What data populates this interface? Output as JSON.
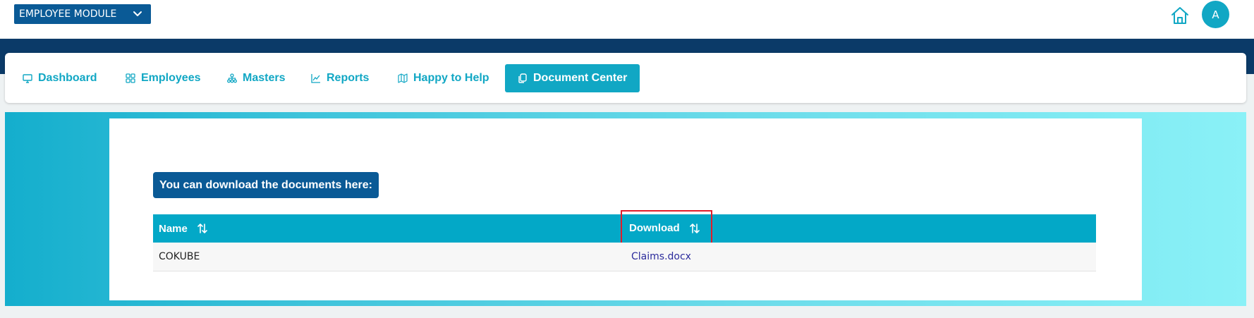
{
  "topbar": {
    "module_label": "EMPLOYEE MODULE",
    "avatar_initial": "A",
    "home_icon": "home-icon",
    "chevron_icon": "chevron-down-icon"
  },
  "nav": {
    "items": [
      {
        "label": "Dashboard",
        "icon": "monitor-icon"
      },
      {
        "label": "Employees",
        "icon": "grid-icon"
      },
      {
        "label": "Masters",
        "icon": "hierarchy-icon"
      },
      {
        "label": "Reports",
        "icon": "chart-line-icon"
      },
      {
        "label": "Happy to Help",
        "icon": "map-icon"
      },
      {
        "label": "Document Center",
        "icon": "documents-icon"
      }
    ],
    "active_index": 5
  },
  "main": {
    "heading": "You can download the documents here:",
    "table": {
      "columns": [
        "Name",
        "Download"
      ],
      "highlighted_column": "Download",
      "rows": [
        {
          "name": "COKUBE",
          "download": "Claims.docx"
        }
      ]
    }
  },
  "colors": {
    "brand_navy": "#0b3a68",
    "module_blue": "#0a5a96",
    "accent_teal": "#11a7c4",
    "table_header": "#03a8c7",
    "highlight_red": "#e11c2a"
  }
}
